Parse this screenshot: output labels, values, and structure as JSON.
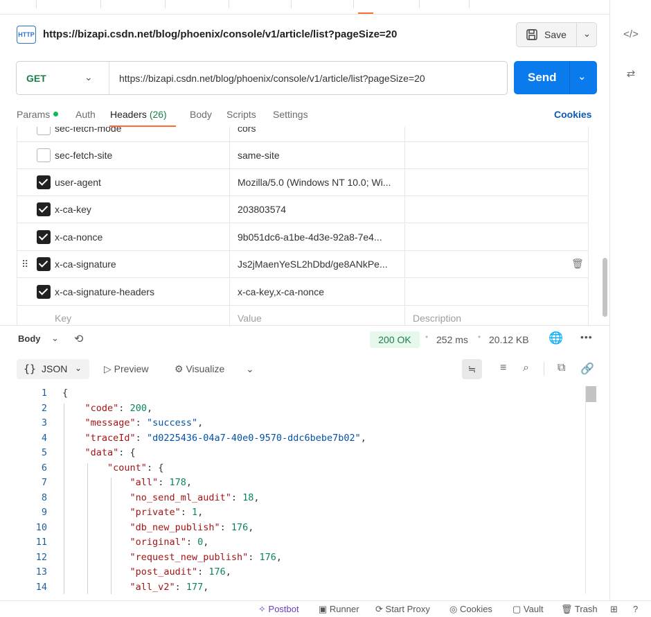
{
  "request": {
    "title": "https://bizapi.csdn.net/blog/phoenix/console/v1/article/list?pageSize=20",
    "method": "GET",
    "url": "https://bizapi.csdn.net/blog/phoenix/console/v1/article/list?pageSize=20",
    "save_label": "Save",
    "send_label": "Send",
    "http_badge": "HTTP"
  },
  "tabs": {
    "params": "Params",
    "auth": "Auth",
    "headers": "Headers",
    "headers_count": "(26)",
    "body": "Body",
    "scripts": "Scripts",
    "settings": "Settings",
    "cookies": "Cookies"
  },
  "headers": [
    {
      "key": "sec-fetch-mode",
      "value": "cors",
      "checked": false
    },
    {
      "key": "sec-fetch-site",
      "value": "same-site",
      "checked": false
    },
    {
      "key": "user-agent",
      "value": "Mozilla/5.0 (Windows NT 10.0; Wi...",
      "checked": true
    },
    {
      "key": "x-ca-key",
      "value": "203803574",
      "checked": true
    },
    {
      "key": "x-ca-nonce",
      "value": "9b051dc6-a1be-4d3e-92a8-7e4...",
      "checked": true
    },
    {
      "key": "x-ca-signature",
      "value": "Js2jMaenYeSL2hDbd/ge8ANkPe...",
      "checked": true
    },
    {
      "key": "x-ca-signature-headers",
      "value": "x-ca-key,x-ca-nonce",
      "checked": true
    }
  ],
  "header_placeholders": {
    "key": "Key",
    "value": "Value",
    "description": "Description"
  },
  "response": {
    "body_label": "Body",
    "status": "200 OK",
    "time": "252 ms",
    "size": "20.12 KB",
    "format": "JSON",
    "preview": "Preview",
    "visualize": "Visualize"
  },
  "code_lines": [
    "{",
    "    \"code\": 200,",
    "    \"message\": \"success\",",
    "    \"traceId\": \"d0225436-04a7-40e0-9570-ddc6bebe7b02\",",
    "    \"data\": {",
    "        \"count\": {",
    "            \"all\": 178,",
    "            \"no_send_ml_audit\": 18,",
    "            \"private\": 1,",
    "            \"db_new_publish\": 176,",
    "            \"original\": 0,",
    "            \"request_new_publish\": 176,",
    "            \"post_audit\": 176,",
    "            \"all_v2\": 177,"
  ],
  "statusbar": {
    "postbot": "Postbot",
    "runner": "Runner",
    "start_proxy": "Start Proxy",
    "cookies": "Cookies",
    "vault": "Vault",
    "trash": "Trash"
  }
}
